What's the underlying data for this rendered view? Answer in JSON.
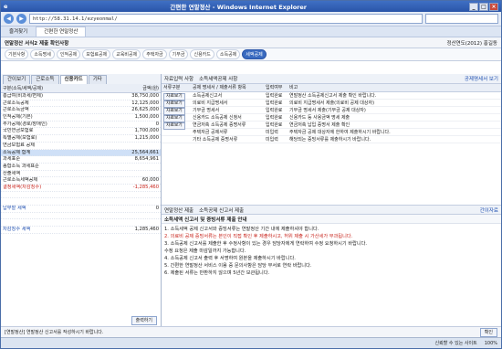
{
  "window": {
    "title": "간편한 연말정산 - Windows Internet Explorer"
  },
  "browser": {
    "url": "http://58.31.14.1/ezyeonmal/",
    "favorites": "즐겨찾기",
    "tab": "간편한 연말정산"
  },
  "app": {
    "title": "연말정산 서식2 제출 확인사항",
    "user": "정산연도(2012) 홍길동",
    "steps": [
      "기본사항",
      "소득명세",
      "인적공제",
      "보험료공제",
      "교육비공제",
      "주택자금",
      "기부금",
      "신용카드",
      "소득공제",
      "세액공제"
    ],
    "active_step": "세액공제"
  },
  "left": {
    "tabs": [
      "간이보기",
      "근로소득",
      "신용카드",
      "기타"
    ],
    "active_tab": "신용카드",
    "header": {
      "name": "구분(소득/세액/공제)",
      "amount": "금액(원)"
    },
    "rows": [
      {
        "name": "총급여(비과세/면제)",
        "amount": "38,750,000"
      },
      {
        "name": "근로소득공제",
        "amount": "12,125,000"
      },
      {
        "name": "근로소득금액",
        "amount": "26,625,000"
      },
      {
        "name": "인적공제(기본)",
        "amount": "1,500,000"
      },
      {
        "name": "추가공제(경로/장애인)",
        "amount": "0"
      },
      {
        "name": "국민연금보험료",
        "amount": "1,700,000"
      },
      {
        "name": "특별공제(보험료)",
        "amount": "1,215,000"
      },
      {
        "name": "연금보험료 공제",
        "amount": ""
      },
      {
        "name": "소득공제 합계",
        "amount": "25,564,661"
      },
      {
        "name": "과세표준",
        "amount": "8,654,961"
      },
      {
        "name": "종합소득 과세표준",
        "amount": ""
      },
      {
        "name": "산출세액",
        "amount": ""
      },
      {
        "name": "근로소득세액공제",
        "amount": "60,000"
      },
      {
        "name": "결정세액(차감징수)",
        "amount": "-1,285,460"
      },
      {
        "name": "",
        "amount": ""
      },
      {
        "name": "",
        "amount": ""
      },
      {
        "name": "납부할 세액",
        "amount": "0"
      },
      {
        "name": "",
        "amount": ""
      },
      {
        "name": "",
        "amount": ""
      },
      {
        "name": "차감징수 세액",
        "amount": "1,285,460"
      }
    ],
    "footer_button": "출력하기"
  },
  "right": {
    "top_tabs": [
      "자료입력 사항",
      "소득세액공제 사항"
    ],
    "top_right": "공제명세서 보기",
    "columns": [
      "서류구분",
      "공제 명세서 / 제출서류 항목",
      "입력여부",
      "비고"
    ],
    "rows": [
      {
        "btn": "자료보기",
        "item": "소득공제신고서",
        "status": "입력완료",
        "note": "연말정산 소득공제신고서 제출 확인 바랍니다."
      },
      {
        "btn": "자료보기",
        "item": "의료비 지급명세서",
        "status": "입력완료",
        "note": "의료비 지급명세서 제출(의료비 공제 대상자)"
      },
      {
        "btn": "자료보기",
        "item": "기부금 명세서",
        "status": "입력완료",
        "note": "기부금 명세서 제출(기부금 공제 대상자)"
      },
      {
        "btn": "자료보기",
        "item": "신용카드 소득공제 신청서",
        "status": "입력완료",
        "note": "신용카드 등 사용금액 명세 제출"
      },
      {
        "btn": "자료보기",
        "item": "연금저축 소득공제 증명서류",
        "status": "입력완료",
        "note": "연금저축 납입 증명서 제출 확인"
      },
      {
        "btn": "",
        "item": "주택자금 공제서류",
        "status": "미입력",
        "note": "주택자금 공제 대상자에 한하여 제출하시기 바랍니다."
      },
      {
        "btn": "",
        "item": "기타 소득공제 증명서류",
        "status": "미입력",
        "note": "해당되는 증빙서류를 제출하시기 바랍니다."
      }
    ],
    "mid_tabs": [
      "연말정산 제출",
      "소득공제 신고서 제출"
    ],
    "mid_right": "간이자료",
    "notice_title": "소득세액 신고서 및 증빙서류 제출 안내",
    "notice_lines": [
      "1. 소득세액 공제 신고서와 증빙서류는 연말정산 기간 내에 제출하셔야 합니다.",
      "2. 의료비 공제 증빙서류는 본인이 직접 확인 후 제출하시고, 허위 제출 시 가산세가 부과됩니다.",
      "3. 소득공제 신고서를 제출한 후 수정사항이 있는 경우 담당자에게 연락하여 수정 요청하시기 바랍니다.",
      "   수정 요청은 제출 마감일까지 가능합니다.",
      "4. 소득공제 신고서 출력 후 서명하여 원본을 제출하시기 바랍니다.",
      "5. 간편한 연말정산 서비스 이용 중 문의사항은 담당 부서로 연락 바랍니다.",
      "6. 제출된 서류는 반환하지 않으며 5년간 보관됩니다."
    ],
    "notice_red_index": 1
  },
  "statusline": {
    "left": "[연말정산] 연말정산 신고서를 작성하시기 바랍니다.",
    "right": "확인"
  },
  "iestatus": {
    "zone": "신뢰할 수 있는 사이트",
    "zoom": "100%"
  }
}
